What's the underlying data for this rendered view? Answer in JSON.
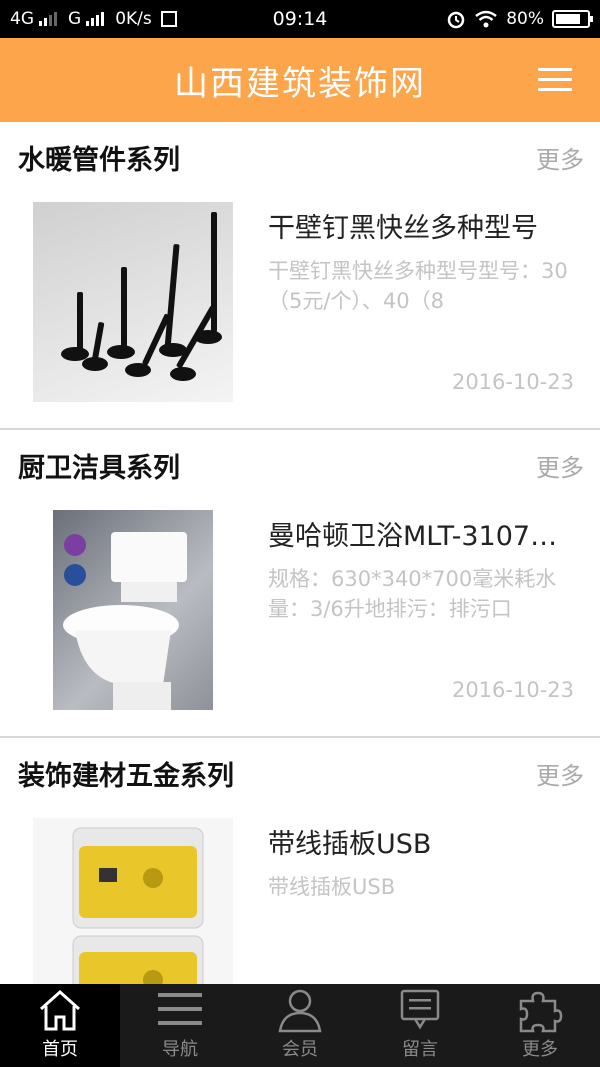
{
  "status_bar": {
    "network1": "4G",
    "network2": "G",
    "speed": "0K/s",
    "time": "09:14",
    "battery": "80%",
    "battery_level": 0.8
  },
  "header": {
    "title": "山西建筑装饰网",
    "menu_icon": "hamburger-menu-icon",
    "background": "#fda54a"
  },
  "sections": [
    {
      "title": "水暖管件系列",
      "more": "更多",
      "item": {
        "title": "干壁钉黑快丝多种型号",
        "desc": "干壁钉黑快丝多种型号型号：30（5元/个）、40（8",
        "date": "2016-10-23",
        "image": "black-screws-photo"
      }
    },
    {
      "title": "厨卫洁具系列",
      "more": "更多",
      "item": {
        "title": "曼哈顿卫浴MLT-3107…",
        "desc": "规格：630*340*700毫米耗水量：3/6升地排污：排污口",
        "date": "2016-10-23",
        "image": "toilet-photo"
      }
    },
    {
      "title": "装饰建材五金系列",
      "more": "更多",
      "item": {
        "title": "带线插板USB",
        "desc": "带线插板USB",
        "date": "",
        "image": "power-strip-photo"
      }
    }
  ],
  "tabs": [
    {
      "label": "首页",
      "icon": "home-icon",
      "active": true
    },
    {
      "label": "导航",
      "icon": "list-icon",
      "active": false
    },
    {
      "label": "会员",
      "icon": "user-icon",
      "active": false
    },
    {
      "label": "留言",
      "icon": "message-icon",
      "active": false
    },
    {
      "label": "更多",
      "icon": "puzzle-icon",
      "active": false
    }
  ]
}
